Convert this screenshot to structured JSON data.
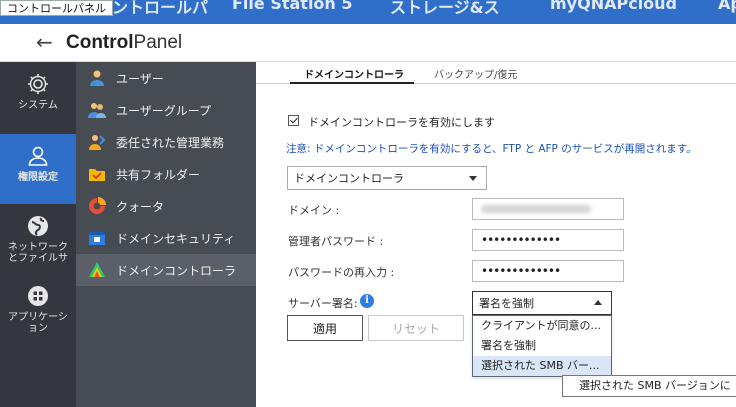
{
  "topbar": {
    "app_label": "コントロールパネル",
    "background_tabs": [
      "コントロールパ",
      "File Station 5",
      "ストレージ&ス",
      "myQNAPcloud",
      "Ap"
    ]
  },
  "header": {
    "back_icon": "arrow-left-icon",
    "title_bold": "Control",
    "title_rest": "Panel"
  },
  "rail": {
    "items": [
      {
        "label": "システム",
        "icon": "gear-icon"
      },
      {
        "label": "権限設定",
        "icon": "user-icon",
        "active": true
      },
      {
        "label_line1": "ネットワーク",
        "label_line2": "とファイルサ",
        "icon": "globe-icon"
      },
      {
        "label_line1": "アプリケーシ",
        "label_line2": "ョン",
        "icon": "apps-icon"
      }
    ]
  },
  "submenu": {
    "items": [
      {
        "label": "ユーザー",
        "icon": "user-icon"
      },
      {
        "label": "ユーザーグループ",
        "icon": "user-group-icon"
      },
      {
        "label": "委任された管理業務",
        "icon": "delegate-icon"
      },
      {
        "label": "共有フォルダー",
        "icon": "folder-icon"
      },
      {
        "label": "クォータ",
        "icon": "quota-icon"
      },
      {
        "label": "ドメインセキュリティ",
        "icon": "domain-security-icon"
      },
      {
        "label": "ドメインコントローラ",
        "icon": "domain-controller-icon",
        "active": true
      }
    ]
  },
  "main": {
    "tabs": [
      {
        "label": "ドメインコントローラ",
        "active": true
      },
      {
        "label": "バックアップ/復元",
        "active": false
      }
    ],
    "enable_checkbox_label": "ドメインコントローラを有効にします",
    "enable_checked": true,
    "note": "注意: ドメインコントローラを有効にすると、FTP と AFP のサービスが再開されます。",
    "mode_select": "ドメインコントローラ",
    "domain_label": "ドメイン :",
    "admin_password_label": "管理者パスワード :",
    "admin_password_value": "•••••••••••••",
    "confirm_password_label": "パスワードの再入力 :",
    "confirm_password_value": "•••••••••••••",
    "server_signing_label": "サーバー署名:",
    "server_signing_selected": "署名を強制",
    "server_signing_options": [
      "クライアントが同意の...",
      "署名を強制",
      "選択された SMB バー..."
    ],
    "apply_label": "適用",
    "reset_label": "リセット",
    "tooltip": "選択された SMB バージョンに"
  },
  "colors": {
    "accent": "#2f6fc9",
    "rail_bg": "#34383e",
    "submenu_bg": "#474b52",
    "note_blue": "#1b4fb8"
  }
}
